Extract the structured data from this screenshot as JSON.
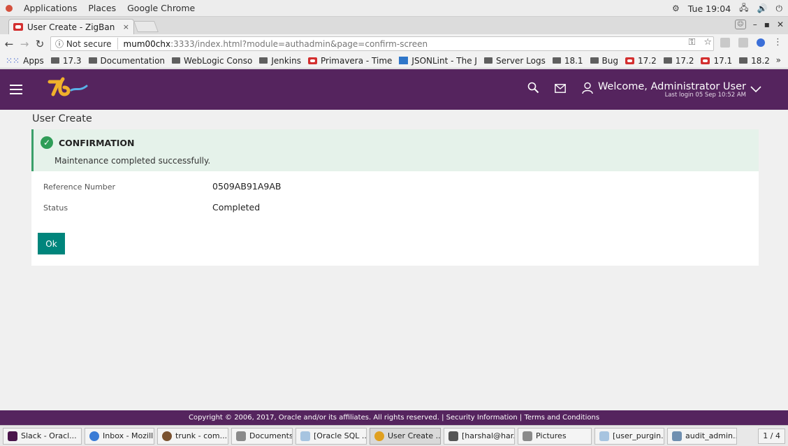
{
  "system_bar": {
    "menus": [
      "Applications",
      "Places",
      "Google Chrome"
    ],
    "clock": "Tue 19:04"
  },
  "browser": {
    "tab_title": "User Create - ZigBan",
    "tab_close": "×",
    "omnibox": {
      "security": "ⓘ Not secure",
      "host": "mum00chx",
      "rest": ":3333/index.html?module=authadmin&page=confirm-screen"
    },
    "bookmarks": [
      {
        "label": "Apps",
        "icon": "apps-grid"
      },
      {
        "label": "17.3",
        "icon": "folder"
      },
      {
        "label": "Documentation",
        "icon": "folder"
      },
      {
        "label": "WebLogic Conso",
        "icon": "folder"
      },
      {
        "label": "Jenkins",
        "icon": "folder"
      },
      {
        "label": "Primavera - Time",
        "icon": "oracle"
      },
      {
        "label": "JSONLint - The J",
        "icon": "json"
      },
      {
        "label": "Server Logs",
        "icon": "folder"
      },
      {
        "label": "18.1",
        "icon": "folder"
      },
      {
        "label": "Bug",
        "icon": "folder"
      },
      {
        "label": "17.2",
        "icon": "oracle"
      },
      {
        "label": "17.2",
        "icon": "folder"
      },
      {
        "label": "17.1",
        "icon": "oracle"
      },
      {
        "label": "18.2",
        "icon": "folder"
      }
    ],
    "bookmarks_more": "»"
  },
  "app": {
    "header": {
      "welcome": "Welcome, Administrator User",
      "last_login": "Last login 05 Sep 10:52 AM"
    },
    "page_title": "User Create",
    "confirmation": {
      "heading": "CONFIRMATION",
      "message": "Maintenance completed successfully."
    },
    "fields": [
      {
        "label": "Reference Number",
        "value": "0509AB91A9AB"
      },
      {
        "label": "Status",
        "value": "Completed"
      }
    ],
    "ok_label": "Ok",
    "footer": "Copyright © 2006, 2017, Oracle and/or its affiliates. All rights reserved. | Security Information | Terms and Conditions"
  },
  "taskbar": {
    "items": [
      {
        "label": "Slack - Oracl...",
        "color": "#4a154b"
      },
      {
        "label": "Inbox - Mozill...",
        "color": "#3a7bd5"
      },
      {
        "label": "trunk - com...",
        "color": "#7a5230"
      },
      {
        "label": "Documents",
        "color": "#8a8a8a"
      },
      {
        "label": "[Oracle SQL ...",
        "color": "#a7c4e0"
      },
      {
        "label": "User Create ...",
        "color": "#e0a020"
      },
      {
        "label": "[harshal@har...",
        "color": "#555555"
      },
      {
        "label": "Pictures",
        "color": "#8a8a8a"
      },
      {
        "label": "[user_purgin...",
        "color": "#a7c4e0"
      },
      {
        "label": "audit_admin...",
        "color": "#6f8fb0"
      }
    ],
    "pager": "1 / 4"
  },
  "colors": {
    "brand_purple": "#55245e",
    "success_green": "#2e9d57",
    "ok_button": "#00857c"
  }
}
